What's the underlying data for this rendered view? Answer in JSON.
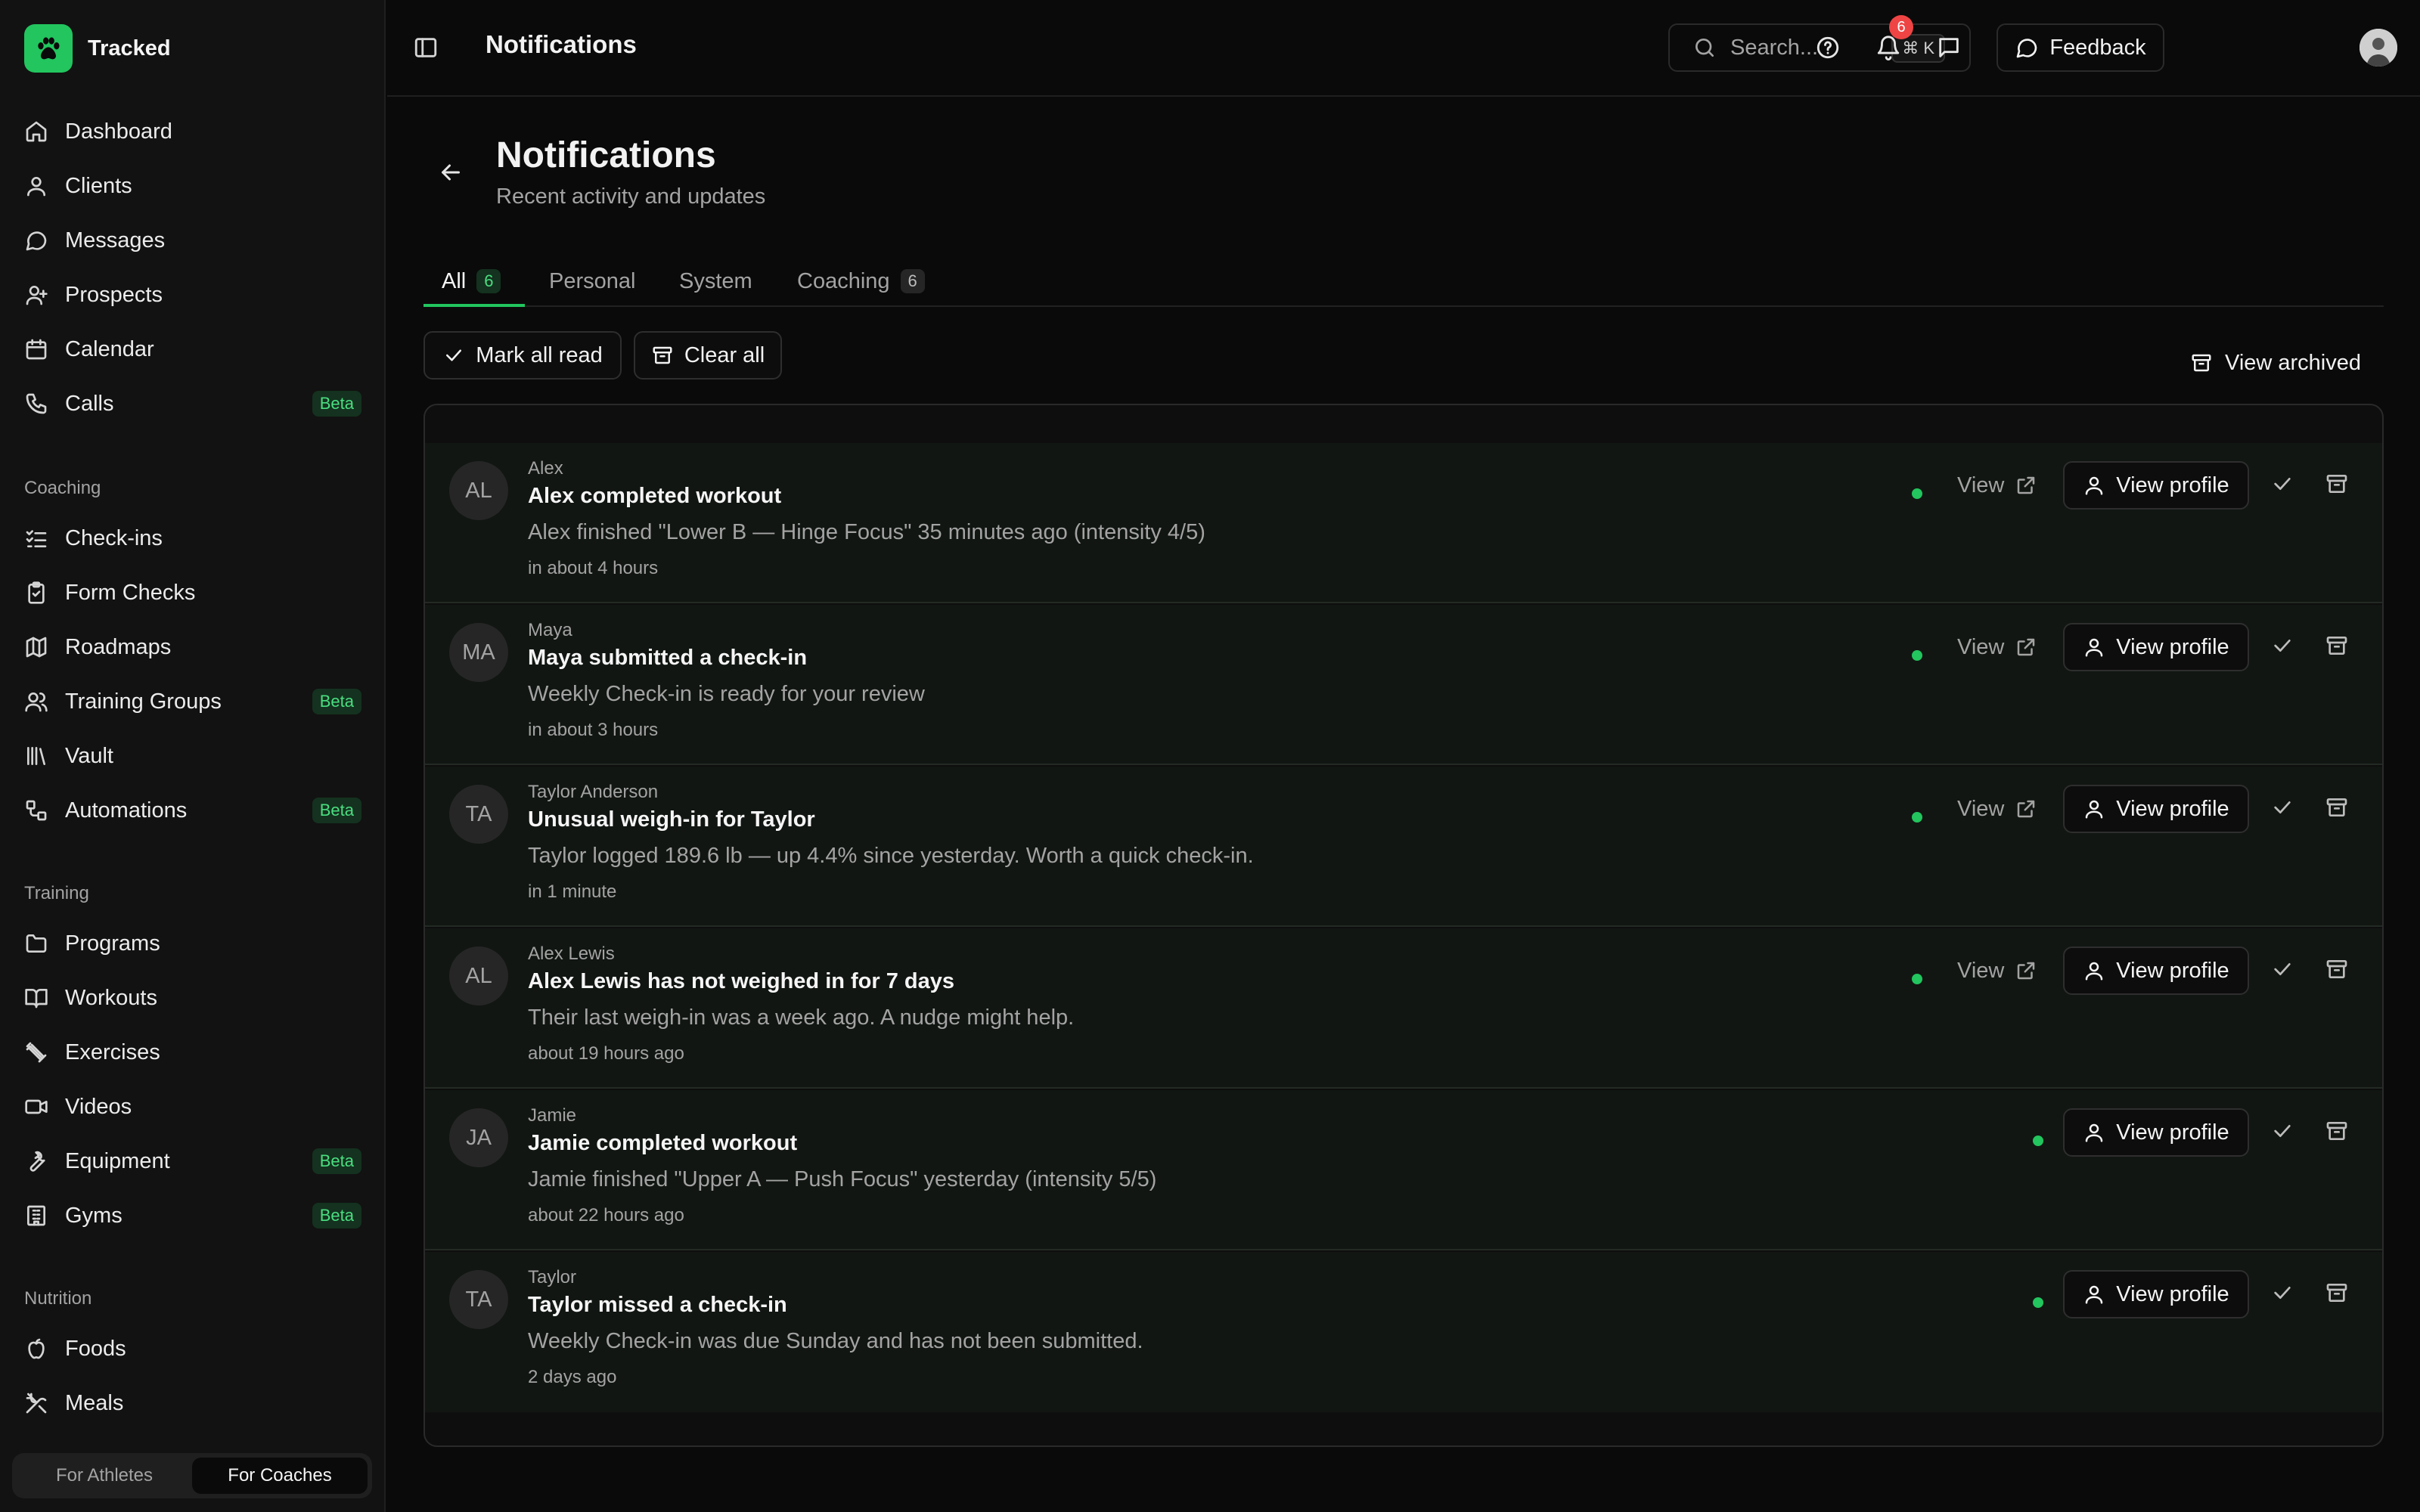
{
  "brand": {
    "name": "Tracked",
    "logo_icon": "paw-icon",
    "accent": "#22c55e"
  },
  "nav_main": [
    {
      "label": "Dashboard",
      "icon": "home-icon"
    },
    {
      "label": "Clients",
      "icon": "user-icon"
    },
    {
      "label": "Messages",
      "icon": "message-icon"
    },
    {
      "label": "Prospects",
      "icon": "user-plus-icon"
    },
    {
      "label": "Calendar",
      "icon": "calendar-icon"
    },
    {
      "label": "Calls",
      "icon": "phone-icon",
      "badge": "Beta"
    }
  ],
  "coaching": {
    "label": "Coaching",
    "items": [
      {
        "label": "Check-ins",
        "icon": "list-check-icon"
      },
      {
        "label": "Form Checks",
        "icon": "clipboard-check-icon"
      },
      {
        "label": "Roadmaps",
        "icon": "map-icon"
      },
      {
        "label": "Training Groups",
        "icon": "users-icon",
        "badge": "Beta"
      },
      {
        "label": "Vault",
        "icon": "library-icon"
      },
      {
        "label": "Automations",
        "icon": "workflow-icon",
        "badge": "Beta"
      }
    ]
  },
  "training": {
    "label": "Training",
    "items": [
      {
        "label": "Programs",
        "icon": "folder-icon"
      },
      {
        "label": "Workouts",
        "icon": "book-icon"
      },
      {
        "label": "Exercises",
        "icon": "dumbbell-icon"
      },
      {
        "label": "Videos",
        "icon": "video-icon"
      },
      {
        "label": "Equipment",
        "icon": "wrench-icon",
        "badge": "Beta"
      },
      {
        "label": "Gyms",
        "icon": "building-icon",
        "badge": "Beta"
      }
    ]
  },
  "nutrition": {
    "label": "Nutrition",
    "items": [
      {
        "label": "Foods",
        "icon": "apple-icon"
      },
      {
        "label": "Meals",
        "icon": "utensils-icon"
      }
    ]
  },
  "mode_switch": {
    "athletes": "For Athletes",
    "coaches": "For Coaches",
    "selected": "For Coaches"
  },
  "topbar": {
    "title": "Notifications",
    "search_placeholder": "Search...",
    "search_shortcut": "⌘ K",
    "feedback_label": "Feedback",
    "notification_count": "6"
  },
  "page": {
    "title": "Notifications",
    "subtitle": "Recent activity and updates"
  },
  "tabs": [
    {
      "label": "All",
      "count": "6",
      "active": true
    },
    {
      "label": "Personal",
      "count": ""
    },
    {
      "label": "System",
      "count": ""
    },
    {
      "label": "Coaching",
      "count": "6"
    }
  ],
  "actions": {
    "mark_all_read": "Mark all read",
    "clear_all": "Clear all",
    "view_archived": "View archived"
  },
  "row_labels": {
    "view": "View",
    "view_profile": "View profile"
  },
  "notifications": [
    {
      "initials": "AL",
      "who": "Alex",
      "title": "Alex completed workout",
      "message": "Alex finished \"Lower B — Hinge Focus\" 35 minutes ago (intensity 4/5)",
      "time": "in about 4 hours",
      "has_view": true,
      "unread": true
    },
    {
      "initials": "MA",
      "who": "Maya",
      "title": "Maya submitted a check-in",
      "message": "Weekly Check-in is ready for your review",
      "time": "in about 3 hours",
      "has_view": true,
      "unread": true
    },
    {
      "initials": "TA",
      "who": "Taylor Anderson",
      "title": "Unusual weigh-in for Taylor",
      "message": "Taylor logged 189.6 lb — up 4.4% since yesterday. Worth a quick check-in.",
      "time": "in 1 minute",
      "has_view": true,
      "unread": true
    },
    {
      "initials": "AL",
      "who": "Alex Lewis",
      "title": "Alex Lewis has not weighed in for 7 days",
      "message": "Their last weigh-in was a week ago. A nudge might help.",
      "time": "about 19 hours ago",
      "has_view": true,
      "unread": true
    },
    {
      "initials": "JA",
      "who": "Jamie",
      "title": "Jamie completed workout",
      "message": "Jamie finished \"Upper A — Push Focus\" yesterday (intensity 5/5)",
      "time": "about 22 hours ago",
      "has_view": false,
      "unread": true
    },
    {
      "initials": "TA",
      "who": "Taylor",
      "title": "Taylor missed a check-in",
      "message": "Weekly Check-in was due Sunday and has not been submitted.",
      "time": "2 days ago",
      "has_view": false,
      "unread": true
    }
  ]
}
